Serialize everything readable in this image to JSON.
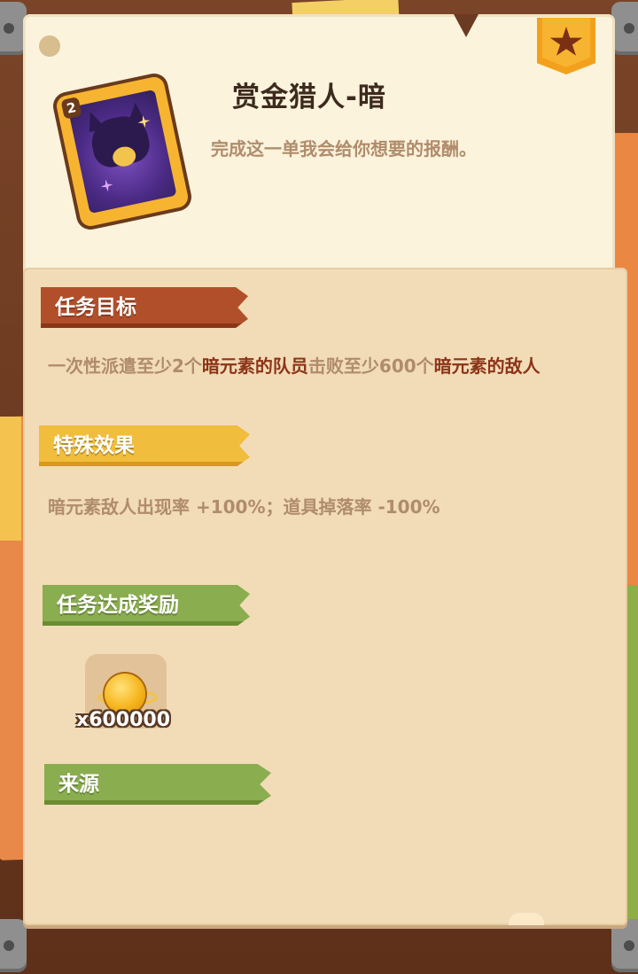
{
  "quest": {
    "title": "赏金猎人-暗",
    "description": "完成这一单我会给你想要的报酬。",
    "card_level": "2"
  },
  "sections": {
    "objective_label": "任务目标",
    "objective_parts": [
      "一次性派遣至少2个",
      "暗元素的队员",
      "击败至少600个",
      "暗元素的敌人"
    ],
    "effect_label": "特殊效果",
    "effect_text": "暗元素敌人出现率 +100%；道具掉落率 -100%",
    "reward_label": "任务达成奖励",
    "source_label": "来源"
  },
  "reward": {
    "icon": "gold-coin-icon",
    "quantity": "x600000"
  },
  "colors": {
    "objective_tag": "#b24f2b",
    "effect_tag": "#f1bd3c",
    "reward_tag": "#8aad4f",
    "highlight_text": "#8c3418",
    "body_text": "#b08c6c"
  }
}
